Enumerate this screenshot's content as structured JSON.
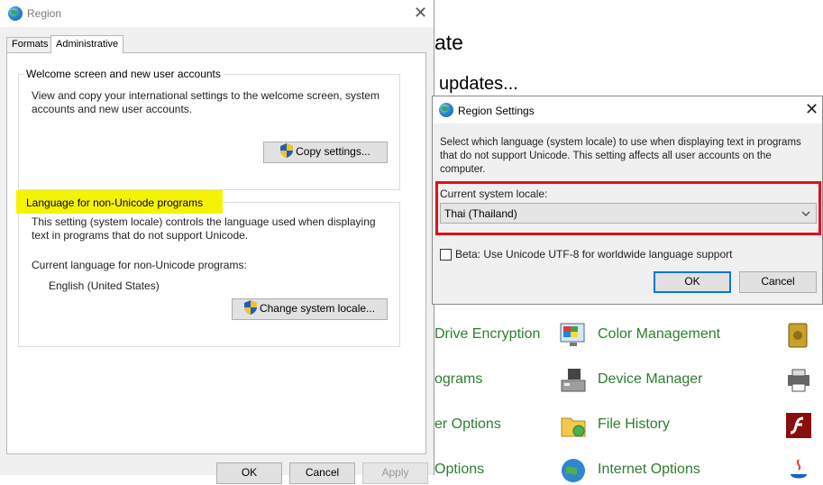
{
  "background": {
    "heading_partial": "ate",
    "subheading_partial": "updates...",
    "items": [
      {
        "label": "Drive Encryption",
        "icon": "bitlocker-icon"
      },
      {
        "label": "Color Management",
        "icon": "color-management-icon"
      },
      {
        "label": "ograms",
        "icon": "programs-icon"
      },
      {
        "label": "Device Manager",
        "icon": "device-manager-icon"
      },
      {
        "label": "er Options",
        "icon": "options-icon"
      },
      {
        "label": "File History",
        "icon": "file-history-icon"
      },
      {
        "label": "Options",
        "icon": "options-icon"
      },
      {
        "label": "Internet Options",
        "icon": "internet-options-icon"
      }
    ],
    "link_color": "#2e7d32"
  },
  "region_dialog": {
    "title": "Region",
    "tabs": [
      "Formats",
      "Administrative"
    ],
    "active_tab": "Administrative",
    "welcome_group": {
      "title": "Welcome screen and new user accounts",
      "line1": "View and copy your international settings to the welcome screen, system",
      "line2": "accounts and new user accounts.",
      "button": "Copy settings..."
    },
    "nonunicode_group": {
      "title": "Language for non-Unicode programs",
      "line1": "This setting (system locale) controls the language used when displaying",
      "line2": "text in programs that do not support Unicode.",
      "current_label": "Current language for non-Unicode programs:",
      "current_value": "English (United States)",
      "button": "Change system locale..."
    },
    "ok": "OK",
    "cancel": "Cancel",
    "apply": "Apply",
    "highlight_color": "#f6f300"
  },
  "region_settings": {
    "title": "Region Settings",
    "line1": "Select which language (system locale) to use when displaying text in programs",
    "line2": "that do not support Unicode. This setting affects all user accounts on the",
    "line3": "computer.",
    "locale_label": "Current system locale:",
    "locale_value": "Thai (Thailand)",
    "beta_label": "Beta: Use Unicode UTF-8 for worldwide language support",
    "beta_checked": false,
    "ok": "OK",
    "cancel": "Cancel",
    "annotation_color": "#e0101b"
  }
}
